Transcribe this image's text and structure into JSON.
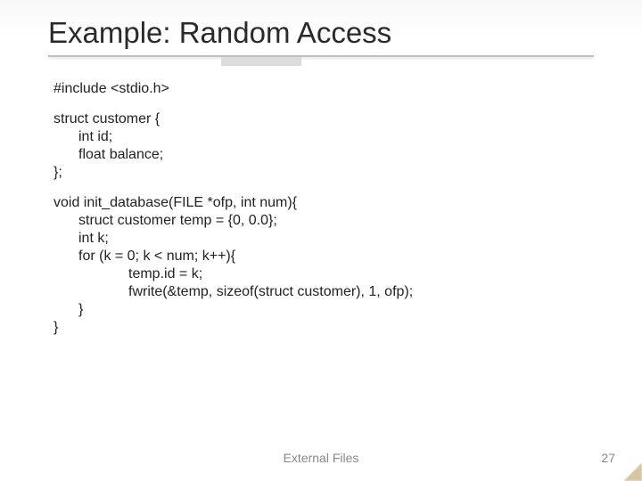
{
  "title": "Example: Random Access",
  "code": {
    "include": "#include <stdio.h>",
    "struct_open": "struct customer {",
    "struct_id": "int id;",
    "struct_balance": "float balance;",
    "struct_close": "};",
    "fn_open": "void init_database(FILE *ofp, int num){",
    "fn_temp": "struct customer temp = {0, 0.0};",
    "fn_k": "int k;",
    "fn_for": "for (k = 0; k < num; k++){",
    "fn_assign": "temp.id = k;",
    "fn_fwrite": "fwrite(&temp, sizeof(struct customer), 1, ofp);",
    "fn_for_close": "}",
    "fn_close": "}"
  },
  "footer": {
    "center": "External Files",
    "page": "27"
  }
}
